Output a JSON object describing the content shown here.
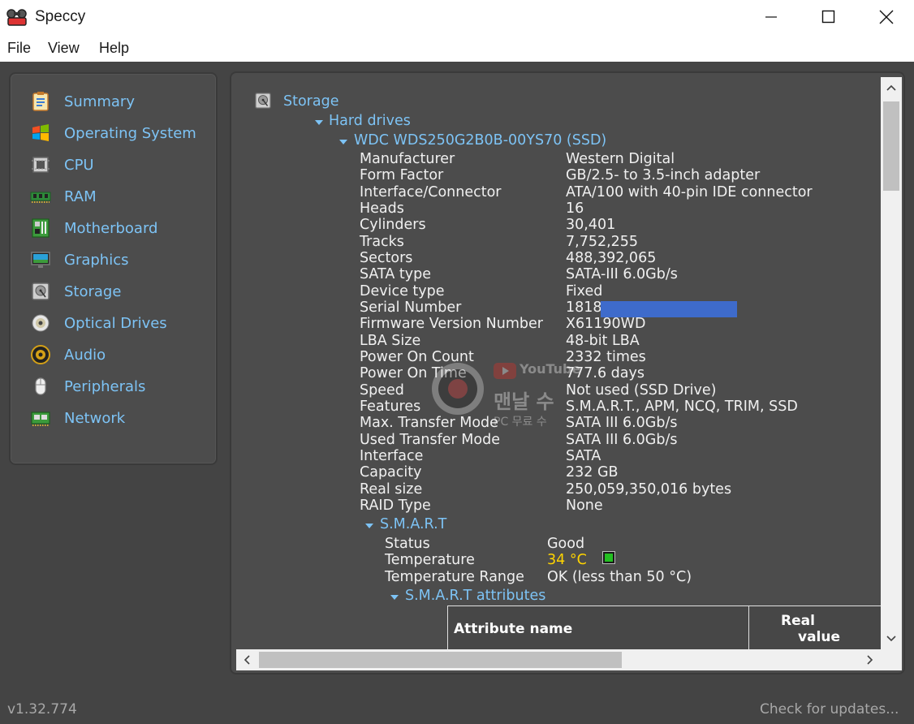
{
  "window": {
    "title": "Speccy",
    "icon": "speccy-app-icon",
    "controls": [
      "minimize-icon",
      "maximize-icon",
      "close-icon"
    ]
  },
  "menu": {
    "file": "File",
    "view": "View",
    "help": "Help"
  },
  "sidebar": {
    "items": [
      {
        "label": "Summary",
        "icon": "summary-icon"
      },
      {
        "label": "Operating System",
        "icon": "windows-icon"
      },
      {
        "label": "CPU",
        "icon": "cpu-icon"
      },
      {
        "label": "RAM",
        "icon": "ram-icon"
      },
      {
        "label": "Motherboard",
        "icon": "motherboard-icon"
      },
      {
        "label": "Graphics",
        "icon": "monitor-icon"
      },
      {
        "label": "Storage",
        "icon": "storage-icon"
      },
      {
        "label": "Optical Drives",
        "icon": "optical-disc-icon"
      },
      {
        "label": "Audio",
        "icon": "speaker-icon"
      },
      {
        "label": "Peripherals",
        "icon": "mouse-icon"
      },
      {
        "label": "Network",
        "icon": "network-icon"
      }
    ]
  },
  "storage": {
    "heading": "Storage",
    "hard_drives": "Hard drives",
    "drive_name": "WDC WDS250G2B0B-00YS70 (SSD)",
    "properties": [
      {
        "key": "Manufacturer",
        "value": "Western Digital"
      },
      {
        "key": "Form Factor",
        "value": "GB/2.5- to 3.5-inch adapter"
      },
      {
        "key": "Interface/Connector",
        "value": "ATA/100 with 40-pin IDE connector"
      },
      {
        "key": "Heads",
        "value": "16"
      },
      {
        "key": "Cylinders",
        "value": "30,401"
      },
      {
        "key": "Tracks",
        "value": "7,752,255"
      },
      {
        "key": "Sectors",
        "value": "488,392,065"
      },
      {
        "key": "SATA type",
        "value": "SATA-III 6.0Gb/s"
      },
      {
        "key": "Device type",
        "value": "Fixed"
      },
      {
        "key": "Serial Number",
        "value": "1818"
      },
      {
        "key": "Firmware Version Number",
        "value": "X61190WD"
      },
      {
        "key": "LBA Size",
        "value": "48-bit LBA"
      },
      {
        "key": "Power On Count",
        "value": "2332 times"
      },
      {
        "key": "Power On Time",
        "value": "777.6 days"
      },
      {
        "key": "Speed",
        "value": "Not used (SSD Drive)"
      },
      {
        "key": "Features",
        "value": "S.M.A.R.T., APM, NCQ, TRIM, SSD"
      },
      {
        "key": "Max. Transfer Mode",
        "value": "SATA III 6.0Gb/s"
      },
      {
        "key": "Used Transfer Mode",
        "value": "SATA III 6.0Gb/s"
      },
      {
        "key": "Interface",
        "value": "SATA"
      },
      {
        "key": "Capacity",
        "value": "232 GB"
      },
      {
        "key": "Real size",
        "value": "250,059,350,016 bytes"
      },
      {
        "key": "RAID Type",
        "value": "None"
      }
    ],
    "smart": {
      "heading": "S.M.A.R.T",
      "status_label": "Status",
      "status_value": "Good",
      "temperature_label": "Temperature",
      "temperature_value": "34 °C",
      "temperature_range_label": "Temperature Range",
      "temperature_range_value": "OK (less than 50 °C)",
      "attributes_heading": "S.M.A.R.T attributes",
      "table_headers": [
        "Attribute name",
        "Real",
        "value"
      ]
    }
  },
  "watermark": {
    "youtube": "YouTube",
    "channel": "맨날 수",
    "subtitle": "PC 무료 수"
  },
  "status": {
    "version": "v1.32.774",
    "update": "Check for updates..."
  }
}
